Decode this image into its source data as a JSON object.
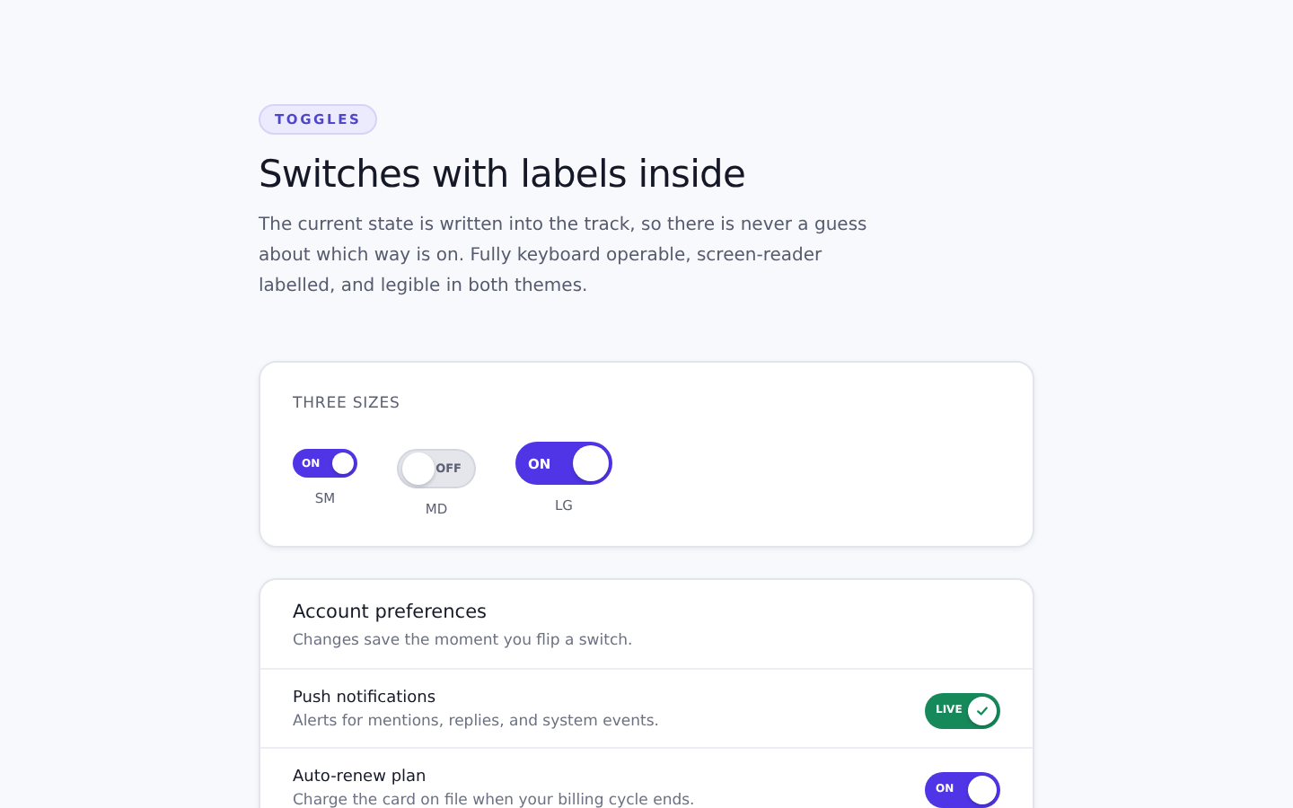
{
  "badge": "TOGGLES",
  "title": "Switches with labels inside",
  "intro": "The current state is written into the track, so there is never a guess about which way is on. Fully keyboard operable, screen-reader labelled, and legible in both themes.",
  "sizes_card": {
    "heading": "THREE SIZES",
    "switches": [
      {
        "kind": "sm",
        "label": "SM",
        "on": true,
        "text": "ON"
      },
      {
        "kind": "md",
        "label": "MD",
        "on": false,
        "text": "OFF"
      },
      {
        "kind": "lg",
        "label": "LG",
        "on": true,
        "text": "ON"
      }
    ]
  },
  "preferences": {
    "title": "Account preferences",
    "subtitle": "Changes save the moment you flip a switch.",
    "rows": [
      {
        "title": "Push notifications",
        "description": "Alerts for mentions, replies, and system events.",
        "switch": {
          "on": true,
          "text": "LIVE",
          "kind": "check",
          "color": "#16895a"
        }
      },
      {
        "title": "Auto-renew plan",
        "description": "Charge the card on file when your billing cycle ends.",
        "switch": {
          "on": true,
          "text": "ON",
          "kind": "plain",
          "color": "#4f35e6"
        }
      }
    ]
  }
}
